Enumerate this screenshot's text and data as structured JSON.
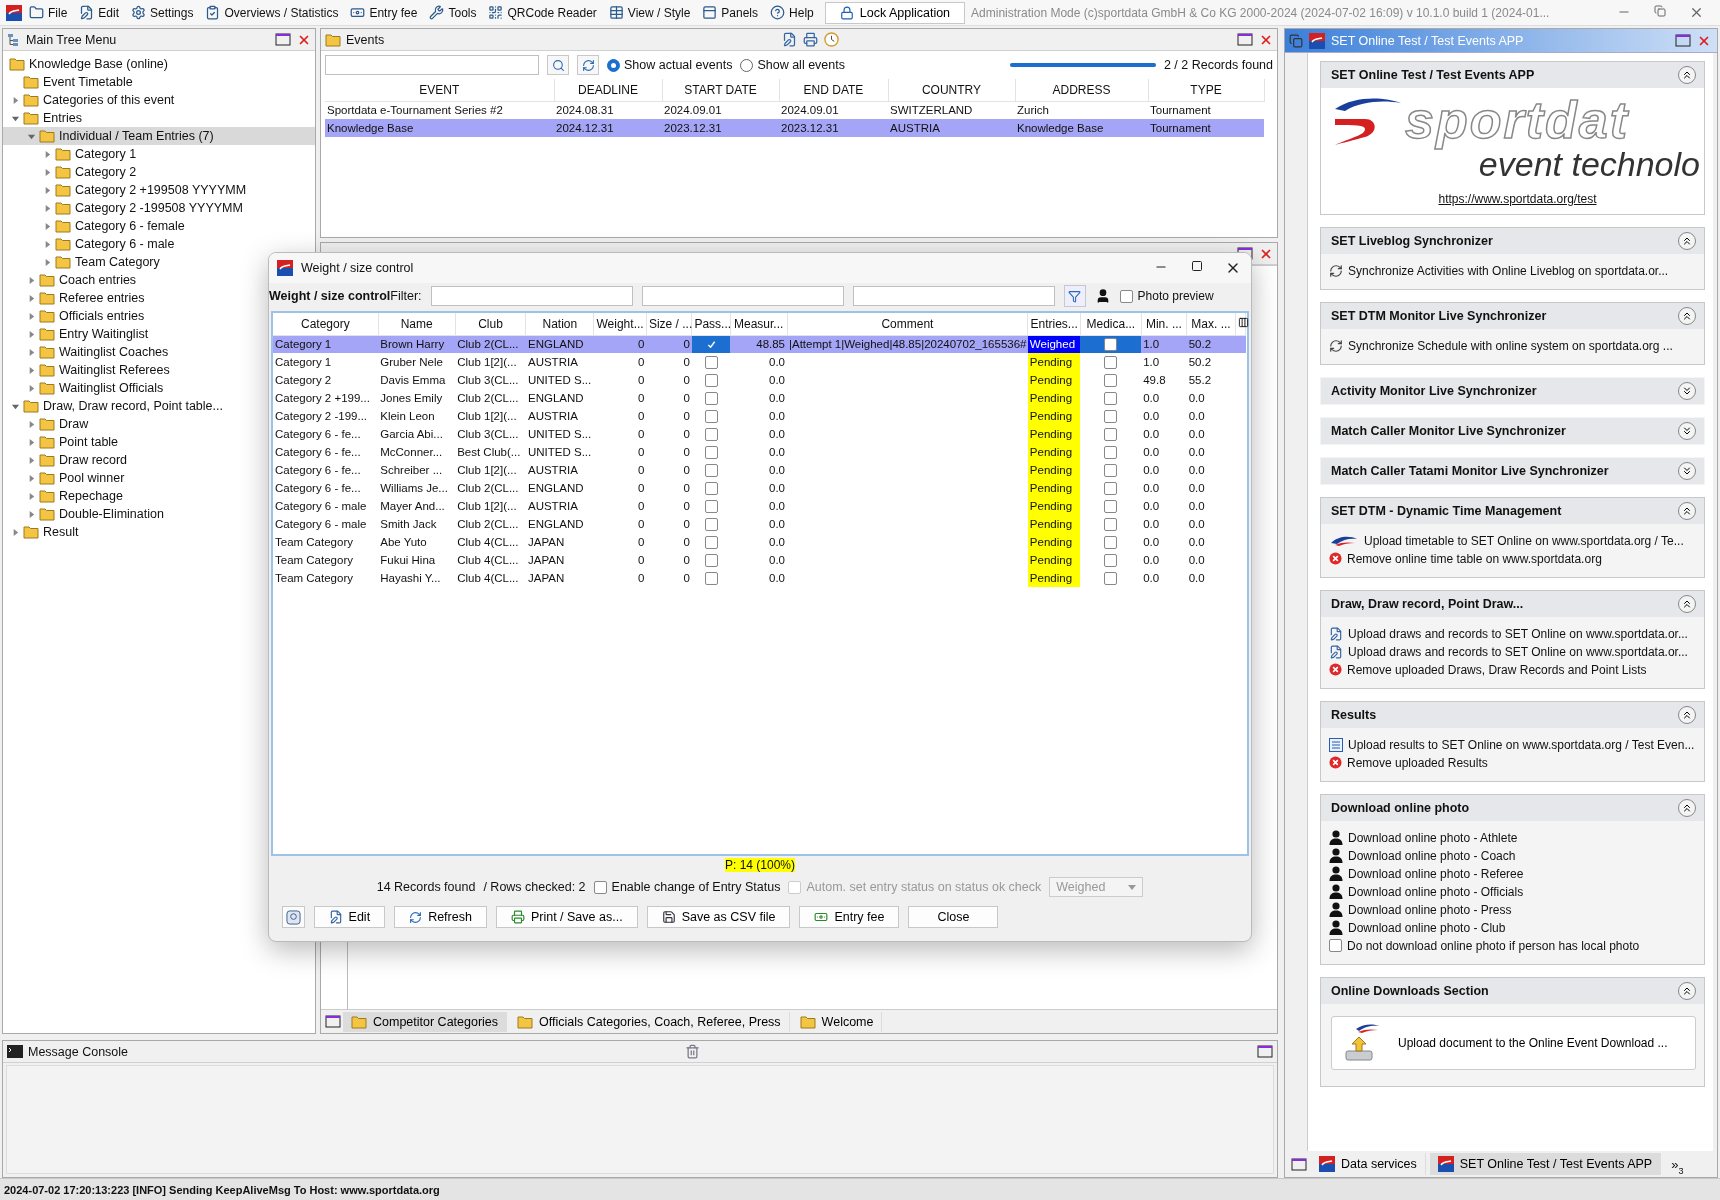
{
  "menu_bar": {
    "items": [
      "File",
      "Edit",
      "Settings",
      "Overviews / Statistics",
      "Entry fee",
      "Tools",
      "QRCode Reader",
      "View / Style",
      "Panels",
      "Help"
    ],
    "lock_button": "Lock Application",
    "title": "Administration Mode (c)sportdata GmbH & Co KG 2000-2024 (2024-07-02 16:09)  v 10.1.0 build 1 (2024-01..."
  },
  "tree_panel": {
    "title": "Main Tree Menu",
    "root": {
      "label": "Knowledge Base (online)",
      "selected": false,
      "children": [
        {
          "label": "Event Timetable",
          "selected": false
        },
        {
          "label": "Categories of this event",
          "selected": false,
          "expanded": false
        },
        {
          "label": "Entries",
          "selected": false,
          "expanded": true,
          "children": [
            {
              "label": "Individual / Team Entries (7)",
              "selected": true,
              "expanded": true,
              "children": [
                {
                  "label": "Category 1",
                  "selected": false,
                  "expanded": false
                },
                {
                  "label": "Category 2",
                  "selected": false,
                  "expanded": false
                },
                {
                  "label": "Category 2 +199508 YYYYMM",
                  "selected": false,
                  "expanded": false
                },
                {
                  "label": "Category 2 -199508 YYYYMM",
                  "selected": false,
                  "expanded": false
                },
                {
                  "label": "Category 6 - female",
                  "selected": false,
                  "expanded": false
                },
                {
                  "label": "Category 6 - male",
                  "selected": false,
                  "expanded": false
                },
                {
                  "label": "Team Category",
                  "selected": false,
                  "expanded": false
                }
              ]
            },
            {
              "label": "Coach entries",
              "selected": false,
              "expanded": false
            },
            {
              "label": "Referee entries",
              "selected": false,
              "expanded": false
            },
            {
              "label": "Officials entries",
              "selected": false,
              "expanded": false
            },
            {
              "label": "Entry Waitinglist",
              "selected": false,
              "expanded": false
            },
            {
              "label": "Waitinglist Coaches",
              "selected": false,
              "expanded": false
            },
            {
              "label": "Waitinglist Referees",
              "selected": false,
              "expanded": false
            },
            {
              "label": "Waitinglist Officials",
              "selected": false,
              "expanded": false
            }
          ]
        },
        {
          "label": "Draw, Draw record, Point table...",
          "selected": false,
          "expanded": true,
          "children": [
            {
              "label": "Draw",
              "selected": false,
              "expanded": false
            },
            {
              "label": "Point table",
              "selected": false,
              "expanded": false
            },
            {
              "label": "Draw record",
              "selected": false,
              "expanded": false
            },
            {
              "label": "Pool winner",
              "selected": false,
              "expanded": false
            },
            {
              "label": "Repechage",
              "selected": false,
              "expanded": false
            },
            {
              "label": "Double-Elimination",
              "selected": false,
              "expanded": false
            }
          ]
        },
        {
          "label": "Result",
          "selected": false,
          "expanded": false
        }
      ]
    }
  },
  "events_panel": {
    "title": "Events",
    "show_options": [
      {
        "label": "Show actual events",
        "selected": true
      },
      {
        "label": "Show all events",
        "selected": false
      }
    ],
    "progress": {
      "level": 1
    },
    "records_found": "2 / 2 Records found",
    "columns": [
      "EVENT",
      "DEADLINE",
      "START DATE",
      "END DATE",
      "COUNTRY",
      "ADDRESS",
      "TYPE"
    ],
    "rows": [
      {
        "selected": false,
        "cells": [
          "Sportdata e-Tournament Series #2",
          "2024.08.31",
          "2024.09.01",
          "2024.09.01",
          "SWITZERLAND",
          "Zurich",
          "Tournament"
        ]
      },
      {
        "selected": true,
        "cells": [
          "Knowledge Base",
          "2024.12.31",
          "2023.12.31",
          "2023.12.31",
          "AUSTRIA",
          "Knowledge Base",
          "Tournament"
        ]
      }
    ]
  },
  "dialog": {
    "title": "Weight / size control",
    "filter_title": "Weight / size control",
    "filter_label": "Filter:",
    "photo_preview": {
      "label": "Photo preview",
      "checked": false
    },
    "columns": [
      "Category",
      "Name",
      "Club",
      "Nation",
      "Weight...",
      "Size / ...",
      "Pass...",
      "Measur...",
      "Comment",
      "Entries...",
      "Medica...",
      "Min. ...",
      "Max. ..."
    ],
    "rows": [
      {
        "selected": true,
        "category": "Category 1",
        "name": "Brown Harry",
        "club": "Club 2(CL...",
        "nation": "ENGLAND",
        "weight": "0",
        "size": "0",
        "passed": true,
        "measurement": "48.85",
        "comment": "|Attempt 1|Weighed|48.85|20240702_165536#",
        "status": "Weighed",
        "color": "#0000ff",
        "medical": false,
        "min": "1.0",
        "max": "50.2"
      },
      {
        "selected": false,
        "category": "Category 1",
        "name": "Gruber Nele",
        "club": "Club 1[2](...",
        "nation": "AUSTRIA",
        "weight": "0",
        "size": "0",
        "passed": false,
        "measurement": "0.0",
        "status": "Pending",
        "color": "#ffff00",
        "medical": false,
        "min": "1.0",
        "max": "50.2"
      },
      {
        "selected": false,
        "category": "Category 2",
        "name": "Davis Emma",
        "club": "Club 3(CL...",
        "nation": "UNITED S...",
        "weight": "0",
        "size": "0",
        "passed": false,
        "measurement": "0.0",
        "status": "Pending",
        "color": "#ffff00",
        "medical": false,
        "min": "49.8",
        "max": "55.2"
      },
      {
        "selected": false,
        "category": "Category 2 +199...",
        "name": "Jones Emily",
        "club": "Club 2(CL...",
        "nation": "ENGLAND",
        "weight": "0",
        "size": "0",
        "passed": false,
        "measurement": "0.0",
        "status": "Pending",
        "color": "#ffff00",
        "medical": false,
        "min": "0.0",
        "max": "0.0"
      },
      {
        "selected": false,
        "category": "Category 2 -199...",
        "name": "Klein Leon",
        "club": "Club 1[2](...",
        "nation": "AUSTRIA",
        "weight": "0",
        "size": "0",
        "passed": false,
        "measurement": "0.0",
        "status": "Pending",
        "color": "#ffff00",
        "medical": false,
        "min": "0.0",
        "max": "0.0"
      },
      {
        "selected": false,
        "category": "Category 6 - fe...",
        "name": "Garcia Abi...",
        "club": "Club 3(CL...",
        "nation": "UNITED S...",
        "weight": "0",
        "size": "0",
        "passed": false,
        "measurement": "0.0",
        "status": "Pending",
        "color": "#ffff00",
        "medical": false,
        "min": "0.0",
        "max": "0.0"
      },
      {
        "selected": false,
        "category": "Category 6 - fe...",
        "name": "McConner...",
        "club": "Best Club(...",
        "nation": "UNITED S...",
        "weight": "0",
        "size": "0",
        "passed": false,
        "measurement": "0.0",
        "status": "Pending",
        "color": "#ffff00",
        "medical": false,
        "min": "0.0",
        "max": "0.0"
      },
      {
        "selected": false,
        "category": "Category 6 - fe...",
        "name": "Schreiber ...",
        "club": "Club 1[2](...",
        "nation": "AUSTRIA",
        "weight": "0",
        "size": "0",
        "passed": false,
        "measurement": "0.0",
        "status": "Pending",
        "color": "#ffff00",
        "medical": false,
        "min": "0.0",
        "max": "0.0"
      },
      {
        "selected": false,
        "category": "Category 6 - fe...",
        "name": "Williams Je...",
        "club": "Club 2(CL...",
        "nation": "ENGLAND",
        "weight": "0",
        "size": "0",
        "passed": false,
        "measurement": "0.0",
        "status": "Pending",
        "color": "#ffff00",
        "medical": false,
        "min": "0.0",
        "max": "0.0"
      },
      {
        "selected": false,
        "category": "Category 6 - male",
        "name": "Mayer And...",
        "club": "Club 1[2](...",
        "nation": "AUSTRIA",
        "weight": "0",
        "size": "0",
        "passed": false,
        "measurement": "0.0",
        "status": "Pending",
        "color": "#ffff00",
        "medical": false,
        "min": "0.0",
        "max": "0.0"
      },
      {
        "selected": false,
        "category": "Category 6 - male",
        "name": "Smith Jack",
        "club": "Club 2(CL...",
        "nation": "ENGLAND",
        "weight": "0",
        "size": "0",
        "passed": false,
        "measurement": "0.0",
        "status": "Pending",
        "color": "#ffff00",
        "medical": false,
        "min": "0.0",
        "max": "0.0"
      },
      {
        "selected": false,
        "category": "Team Category",
        "name": "Abe Yuto",
        "club": "Club 4(CL...",
        "nation": "JAPAN",
        "weight": "0",
        "size": "0",
        "passed": false,
        "measurement": "0.0",
        "status": "Pending",
        "color": "#ffff00",
        "medical": false,
        "min": "0.0",
        "max": "0.0"
      },
      {
        "selected": false,
        "category": "Team Category",
        "name": "Fukui Hina",
        "club": "Club 4(CL...",
        "nation": "JAPAN",
        "weight": "0",
        "size": "0",
        "passed": false,
        "measurement": "0.0",
        "status": "Pending",
        "color": "#ffff00",
        "medical": false,
        "min": "0.0",
        "max": "0.0"
      },
      {
        "selected": false,
        "category": "Team Category",
        "name": "Hayashi Y...",
        "club": "Club 4(CL...",
        "nation": "JAPAN",
        "weight": "0",
        "size": "0",
        "passed": false,
        "measurement": "0.0",
        "status": "Pending",
        "color": "#ffff00",
        "medical": false,
        "min": "0.0",
        "max": "0.0"
      }
    ],
    "progress_note": "P: 14 (100%)",
    "records_found": "14 Records found",
    "rows_checked": "/ Rows checked: 2",
    "enable_change": {
      "label": "Enable change of Entry Status",
      "checked": false
    },
    "auto_set": {
      "label": "Autom. set entry status on status ok check",
      "checked": false,
      "disabled": true
    },
    "status_select": {
      "value": "Weighed",
      "disabled": true
    },
    "buttons": [
      "Edit",
      "Refresh",
      "Print / Save as...",
      "Save as CSV file",
      "Entry fee",
      "Close"
    ]
  },
  "center_tabs": [
    {
      "label": "Competitor Categories",
      "selected": true
    },
    {
      "label": "Officials Categories, Coach, Referee, Press",
      "selected": false
    },
    {
      "label": "Welcome",
      "selected": false
    }
  ],
  "console": {
    "title": "Message Console"
  },
  "right_panel": {
    "title": "SET Online Test / Test Events APP",
    "sections": [
      {
        "title": "SET Online Test / Test Events APP",
        "expanded": true,
        "logo": {
          "line_1": "sportdat",
          "line_2": "event technolo"
        },
        "link": "https://www.sportdata.org/test"
      },
      {
        "title": "SET Liveblog Synchronizer",
        "expanded": true,
        "items": [
          {
            "kind": "sync",
            "label": "Synchronize Activities with Online Liveblog on sportdata.or..."
          }
        ]
      },
      {
        "title": "SET DTM Monitor Live Synchronizer",
        "expanded": true,
        "items": [
          {
            "kind": "sync",
            "label": "Synchronize Schedule with online system on sportdata.org ..."
          }
        ]
      },
      {
        "title": "Activity Monitor Live Synchronizer",
        "expanded": false
      },
      {
        "title": "Match Caller Monitor Live Synchronizer",
        "expanded": false
      },
      {
        "title": "Match Caller Tatami Monitor Live Synchronizer",
        "expanded": false
      },
      {
        "title": "SET DTM - Dynamic Time Management",
        "expanded": true,
        "items": [
          {
            "kind": "swoosh",
            "label": "Upload timetable to SET Online on www.sportdata.org / Te..."
          },
          {
            "kind": "remove",
            "label": "Remove online time table on www.sportdata.org"
          }
        ]
      },
      {
        "title": "Draw, Draw record, Point Draw...",
        "expanded": true,
        "items": [
          {
            "kind": "upload",
            "label": "Upload draws and records to SET Online on www.sportdata.or..."
          },
          {
            "kind": "upload",
            "label": "Upload draws and records to SET Online on www.sportdata.or..."
          },
          {
            "kind": "remove",
            "label": "Remove uploaded Draws, Draw Records and Point Lists"
          }
        ]
      },
      {
        "title": "Results",
        "expanded": true,
        "items": [
          {
            "kind": "list",
            "label": "Upload results to SET Online on www.sportdata.org / Test Even..."
          },
          {
            "kind": "remove",
            "label": "Remove uploaded Results"
          }
        ]
      },
      {
        "title": "Download online photo",
        "expanded": true,
        "items": [
          {
            "kind": "person",
            "label": "Download online photo - Athlete"
          },
          {
            "kind": "person",
            "label": "Download online photo - Coach"
          },
          {
            "kind": "person",
            "label": "Download online photo - Referee"
          },
          {
            "kind": "person",
            "label": "Download online photo - Officials"
          },
          {
            "kind": "person",
            "label": "Download online photo - Press"
          },
          {
            "kind": "person",
            "label": "Download online photo - Club"
          },
          {
            "kind": "checkbox",
            "label": "Do not download online photo if person has local photo",
            "checked": false
          }
        ]
      },
      {
        "title": "Online Downloads Section",
        "expanded": true,
        "items": [
          {
            "kind": "document",
            "label": "Upload document to the Online Event Download ..."
          }
        ]
      }
    ],
    "tabs": [
      {
        "label": "Data services",
        "selected": false
      },
      {
        "label": "SET Online Test / Test Events APP",
        "selected": true
      }
    ],
    "overflow": {
      "mark": "»",
      "count": "3"
    }
  },
  "status_bar": "2024-07-02 17:20:13:223 [INFO] Sending KeepAliveMsg To Host: www.sportdata.org"
}
